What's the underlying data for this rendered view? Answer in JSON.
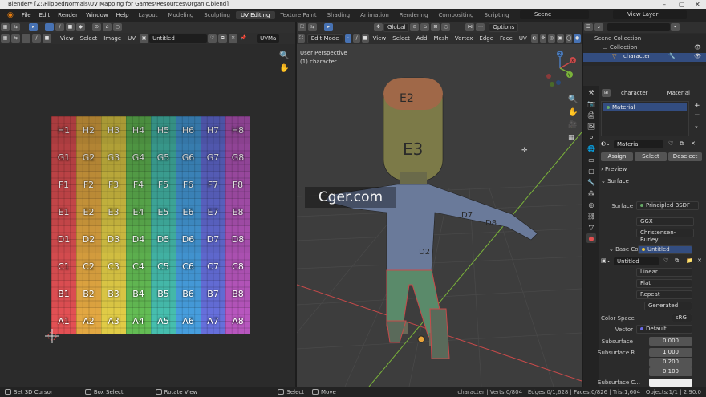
{
  "title": "Blender* [Z:\\FlippedNormals\\UV Mapping for Games\\Resources\\Organic.blend]",
  "menu": [
    "File",
    "Edit",
    "Render",
    "Window",
    "Help"
  ],
  "workspaces": [
    "Layout",
    "Modeling",
    "Sculpting",
    "UV Editing",
    "Texture Paint",
    "Shading",
    "Animation",
    "Rendering",
    "Compositing",
    "Scripting"
  ],
  "active_workspace": "UV Editing",
  "add_tab": "+",
  "scene": "Scene",
  "view_layer": "View Layer",
  "uv_editor": {
    "menus": [
      "View",
      "Select",
      "Image",
      "UV"
    ],
    "image_name": "Untitled",
    "uvmap": "UVMa"
  },
  "uv_grid": {
    "rows": [
      "H",
      "G",
      "F",
      "E",
      "D",
      "C",
      "B",
      "A"
    ],
    "cols": [
      "1",
      "2",
      "3",
      "4",
      "5",
      "6",
      "7",
      "8"
    ]
  },
  "viewport": {
    "mode": "Edit Mode",
    "orientation": "Global",
    "menus": [
      "View",
      "Select",
      "Add",
      "Mesh",
      "Vertex",
      "Edge",
      "Face",
      "UV"
    ],
    "options": "Options",
    "overlay1": "User Perspective",
    "overlay2": "(1) character",
    "gizmo": {
      "x": "X",
      "y": "Y",
      "z": "Z"
    },
    "labels": [
      "E3",
      "E2",
      "D7",
      "D8",
      "D2"
    ]
  },
  "watermark": "Cger.com",
  "outliner": {
    "collection_root": "Scene Collection",
    "collection": "Collection",
    "object": "character"
  },
  "properties": {
    "object": "character",
    "material_tab": "Material",
    "slot": "Material",
    "material_name": "Material",
    "assign": "Assign",
    "select": "Select",
    "deselect": "Deselect",
    "preview": "Preview",
    "surface_panel": "Surface",
    "surface_label": "Surface",
    "surface_value": "Principled BSDF",
    "dist": "GGX",
    "sss": "Christensen-Burley",
    "base_color_label": "Base Col...",
    "base_color_value": "Untitled",
    "image": "Untitled",
    "interp": "Linear",
    "proj": "Flat",
    "ext": "Repeat",
    "source": "Generated",
    "cs_label": "Color Space",
    "cs_value": "sRG",
    "vector_label": "Vector",
    "vector_value": "Default",
    "subsurface_label": "Subsurface",
    "subsurface_value": "0.000",
    "radius_label": "Subsurface R...",
    "radius": [
      "1.000",
      "0.200",
      "0.100"
    ],
    "subsurface_color_label": "Subsurface C..."
  },
  "status": {
    "left": [
      "Set 3D Cursor",
      "Box Select",
      "Rotate View",
      "Select",
      "Move"
    ],
    "right": "character | Verts:0/804 | Edges:0/1,628 | Faces:0/826 | Tris:1,604 | Objects:1/1 | 2.90.0"
  },
  "colors": {
    "H": "#c8474a",
    "G": "#c8943a",
    "F": "#c6b43e",
    "E": "#58a64a",
    "D": "#3ea89a",
    "C": "#3e8bc4",
    "B": "#5a62c2",
    "A": "#a24ca8"
  }
}
